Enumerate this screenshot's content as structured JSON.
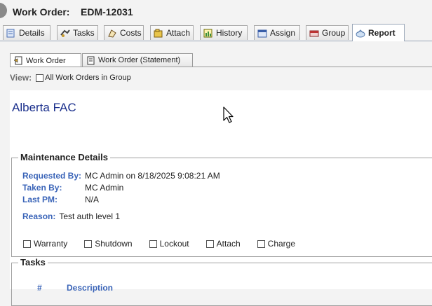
{
  "window": {
    "title_label": "Work Order:",
    "title_value": "EDM-12031"
  },
  "tabs": [
    {
      "label": "Details",
      "icon": "details-icon"
    },
    {
      "label": "Tasks",
      "icon": "tasks-icon"
    },
    {
      "label": "Costs",
      "icon": "costs-icon"
    },
    {
      "label": "Attach",
      "icon": "attach-icon"
    },
    {
      "label": "History",
      "icon": "history-icon"
    },
    {
      "label": "Assign",
      "icon": "assign-icon"
    },
    {
      "label": "Group",
      "icon": "group-icon"
    },
    {
      "label": "Report",
      "icon": "report-icon",
      "active": true
    }
  ],
  "subtabs": [
    {
      "label": "Work Order",
      "active": true
    },
    {
      "label": "Work Order (Statement)",
      "active": false
    }
  ],
  "view": {
    "label": "View:",
    "checkbox_label": "All Work Orders in Group",
    "checked": false
  },
  "report": {
    "org_name": "Alberta FAC",
    "maintenance": {
      "legend": "Maintenance Details",
      "requested_by_label": "Requested By:",
      "requested_by_value": "MC Admin on 8/18/2025 9:08:21 AM",
      "taken_by_label": "Taken By:",
      "taken_by_value": "MC Admin",
      "last_pm_label": "Last PM:",
      "last_pm_value": "N/A",
      "reason_label": "Reason:",
      "reason_value": "Test auth level 1",
      "flags": [
        {
          "label": "Warranty",
          "checked": false
        },
        {
          "label": "Shutdown",
          "checked": false
        },
        {
          "label": "Lockout",
          "checked": false
        },
        {
          "label": "Attach",
          "checked": false
        },
        {
          "label": "Charge",
          "checked": false
        }
      ]
    },
    "tasks": {
      "legend": "Tasks",
      "col_num": "#",
      "col_desc": "Description"
    }
  },
  "colors": {
    "accent_text": "#3a64b8",
    "org_name": "#1a2f8c",
    "tab_border": "#9aa7b8"
  }
}
